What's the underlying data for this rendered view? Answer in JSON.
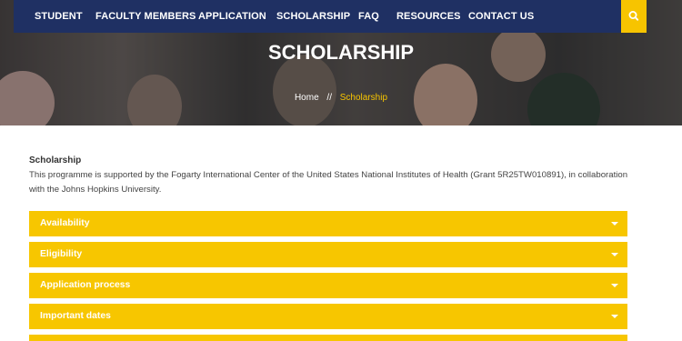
{
  "nav": {
    "items": [
      {
        "label": "STUDENT"
      },
      {
        "label": "FACULTY MEMBERS"
      },
      {
        "label": "APPLICATION"
      },
      {
        "label": "SCHOLARSHIP"
      },
      {
        "label": "FAQ"
      },
      {
        "label": "RESOURCES"
      },
      {
        "label": "CONTACT US"
      }
    ],
    "search_icon": "search-icon"
  },
  "hero": {
    "title": "SCHOLARSHIP",
    "breadcrumb": {
      "home": "Home",
      "separator": "//",
      "current": "Scholarship"
    }
  },
  "content": {
    "title": "Scholarship",
    "text": "This programme is supported by the Fogarty International Center of the United States National Institutes of Health (Grant 5R25TW010891), in collaboration with the Johns Hopkins University."
  },
  "accordion": [
    {
      "label": "Availability"
    },
    {
      "label": "Eligibility"
    },
    {
      "label": "Application process"
    },
    {
      "label": "Important dates"
    },
    {
      "label": ""
    }
  ],
  "colors": {
    "nav_bg": "#1f3063",
    "accent": "#f7c400",
    "accordion_bg": "#f7c600",
    "text": "#444444"
  }
}
